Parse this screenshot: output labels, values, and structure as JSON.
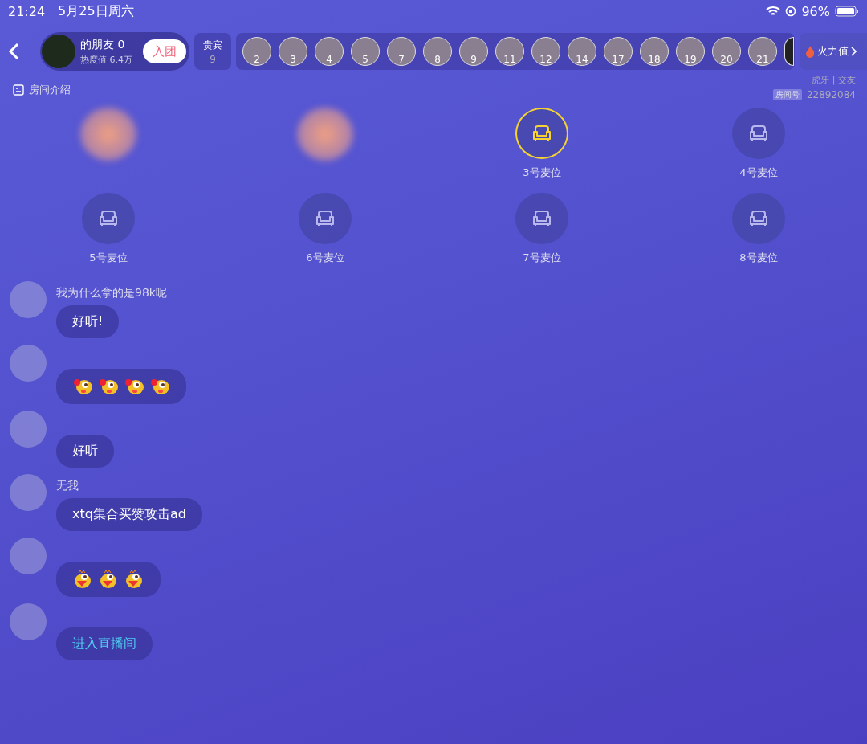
{
  "status_bar": {
    "time": "21:24",
    "date": "5月25日周六",
    "battery": "96%"
  },
  "room": {
    "name": "的朋友 0",
    "heat": "热度值 6.4万",
    "join_button": "入团",
    "vip": {
      "label": "贵宾",
      "count": "9"
    },
    "viewers": [
      "2",
      "3",
      "4",
      "5",
      "7",
      "8",
      "9",
      "11",
      "12",
      "14",
      "17",
      "18",
      "19",
      "20",
      "21"
    ],
    "fire_label": "火力值",
    "intro": "房间介绍",
    "platform": "虎牙 | 交友",
    "room_id_label": "房间号",
    "room_id": "22892084"
  },
  "seats": [
    {
      "kind": "occupied",
      "selected": false
    },
    {
      "kind": "occupied",
      "selected": false
    },
    {
      "kind": "empty",
      "label": "3号麦位",
      "selected": true
    },
    {
      "kind": "empty",
      "label": "4号麦位",
      "selected": false
    },
    {
      "kind": "empty",
      "label": "5号麦位",
      "selected": false
    },
    {
      "kind": "empty",
      "label": "6号麦位",
      "selected": false
    },
    {
      "kind": "empty",
      "label": "7号麦位",
      "selected": false
    },
    {
      "kind": "empty",
      "label": "8号麦位",
      "selected": false
    }
  ],
  "chat": [
    {
      "name": "我为什么拿的是98k呢",
      "kind": "text",
      "text": "好听!"
    },
    {
      "kind": "stickers",
      "stickers": [
        {
          "kind": "rose"
        },
        {
          "kind": "rose"
        },
        {
          "kind": "rose"
        },
        {
          "kind": "rose"
        }
      ]
    },
    {
      "kind": "text",
      "text": "好听"
    },
    {
      "name": "无我",
      "kind": "text",
      "text": "xtq集合买赞攻击ad"
    },
    {
      "kind": "stickers",
      "stickers": [
        {
          "kind": "laugh"
        },
        {
          "kind": "laugh"
        },
        {
          "kind": "laugh"
        }
      ]
    },
    {
      "kind": "link",
      "text": "进入直播间"
    }
  ]
}
